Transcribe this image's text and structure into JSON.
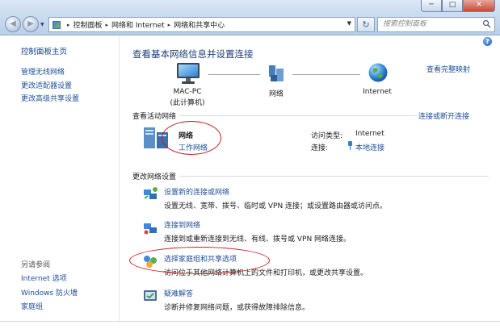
{
  "window": {
    "controls": {
      "minimize": "─",
      "maximize": "□",
      "close": "✕"
    }
  },
  "toolbar": {
    "back": "◀",
    "forward": "▶",
    "history_drop": "▼",
    "breadcrumbs": [
      "控制面板",
      "网络和 Internet",
      "网络和共享中心"
    ],
    "breadcrumb_sep": "▸",
    "address_drop": "▼",
    "refresh": "↻",
    "search_placeholder": "搜索控制面板"
  },
  "sidebar": {
    "home": "控制面板主页",
    "tasks": [
      "管理无线网络",
      "更改适配器设置",
      "更改高级共享设置"
    ],
    "see_also_heading": "另请参阅",
    "see_also": [
      "Internet 选项",
      "Windows 防火墙",
      "家庭组"
    ]
  },
  "main": {
    "help": "?",
    "title": "查看基本网络信息并设置连接",
    "full_map_link": "查看完整映射",
    "nodes": [
      {
        "label": "MAC-PC",
        "sub": "(此计算机)"
      },
      {
        "label": "网络"
      },
      {
        "label": "Internet"
      }
    ],
    "active_section": "查看活动网络",
    "connect_link": "连接或断开连接",
    "active_network": {
      "name": "网络",
      "type": "工作网络",
      "access_type_label": "访问类型:",
      "access_type_value": "Internet",
      "connections_label": "连接:",
      "connections_value": "本地连接"
    },
    "change_section": "更改网络设置",
    "tasks": [
      {
        "link": "设置新的连接或网络",
        "desc": "设置无线、宽带、拨号、临时或 VPN 连接；或设置路由器或访问点。"
      },
      {
        "link": "连接到网络",
        "desc": "连接到或重新连接到无线、有线、拨号或 VPN 网络连接。"
      },
      {
        "link": "选择家庭组和共享选项",
        "desc": "访问位于其他网络计算机上的文件和打印机，或更改共享设置。"
      },
      {
        "link": "疑难解答",
        "desc": "诊断并修复网络问题，或获得故障排除信息。"
      }
    ]
  },
  "colors": {
    "link": "#1d4f9c",
    "annotation": "#c71f1f",
    "title": "#1e3f7a"
  }
}
